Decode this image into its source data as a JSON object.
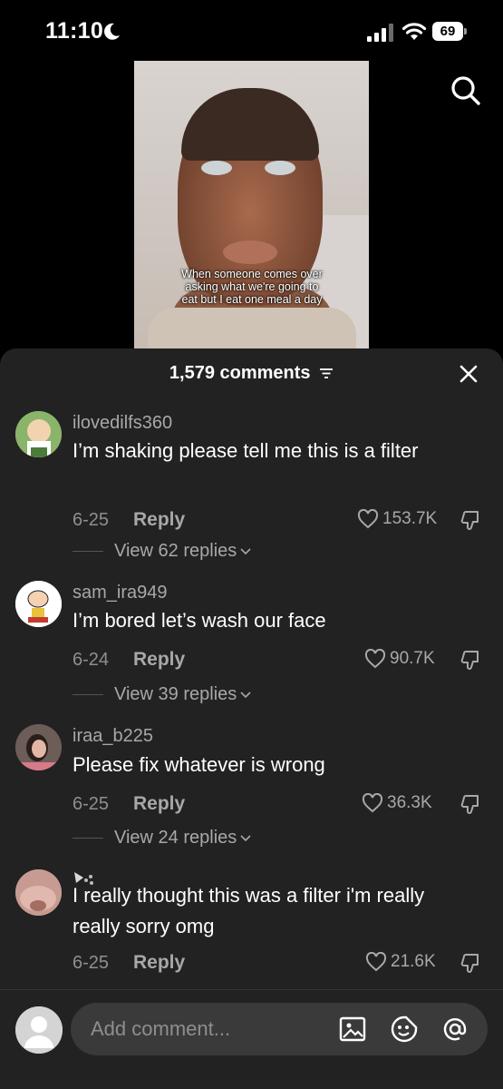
{
  "status_bar": {
    "time": "11:10",
    "battery": "69"
  },
  "video": {
    "caption": "When someone comes over\nasking what we're going to\neat but I eat one meal a day"
  },
  "sheet": {
    "comment_count": "1,579 comments"
  },
  "comments": [
    {
      "username": "ilovedilfs360",
      "text": "I’m shaking please tell me this is a filter",
      "date": "6-25",
      "reply": "Reply",
      "likes": "153.7K",
      "view_replies": "View 62 replies"
    },
    {
      "username": "sam_ira949",
      "text": "I’m bored let’s wash our face",
      "date": "6-24",
      "reply": "Reply",
      "likes": "90.7K",
      "view_replies": "View 39 replies"
    },
    {
      "username": "iraa_b225",
      "text": "Please fix whatever is wrong",
      "date": "6-25",
      "reply": "Reply",
      "likes": "36.3K",
      "view_replies": "View 24 replies"
    },
    {
      "username": "",
      "text": "I really thought this was a filter i'm really really sorry omg",
      "date": "6-25",
      "reply": "Reply",
      "likes": "21.6K"
    }
  ],
  "input": {
    "placeholder": "Add comment..."
  },
  "colors": {
    "sheet_bg": "#222222",
    "input_bg": "#3a3a3a",
    "muted_text": "#a8a8a8"
  },
  "icons": [
    "moon-icon",
    "signal-icon",
    "wifi-icon",
    "search-icon",
    "filter-icon",
    "close-icon",
    "heart-icon",
    "dislike-icon",
    "chevron-down-icon",
    "image-icon",
    "emoji-icon",
    "at-icon"
  ]
}
